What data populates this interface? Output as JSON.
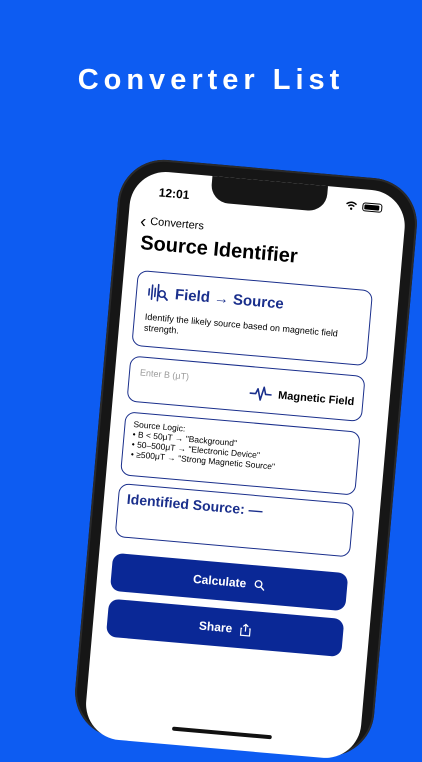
{
  "promo": {
    "title": "Converter List"
  },
  "status": {
    "time": "12:01"
  },
  "nav": {
    "back_label": "Converters"
  },
  "page": {
    "title": "Source Identifier"
  },
  "header_card": {
    "heading": "Field → Source",
    "description": "Identify the likely source based on magnetic field strength."
  },
  "input": {
    "placeholder": "Enter B (μT)",
    "label": "Magnetic Field"
  },
  "logic": {
    "title": "Source Logic:",
    "lines": [
      "• B < 50μT → \"Background\"",
      "• 50–500μT → \"Electronic Device\"",
      "• ≥500μT → \"Strong Magnetic Source\""
    ]
  },
  "result": {
    "label": "Identified Source: —"
  },
  "buttons": {
    "calculate": "Calculate",
    "share": "Share"
  },
  "colors": {
    "background": "#0d5cf2",
    "accent": "#0a2896",
    "card_border": "#1a2f8c"
  },
  "icons": {
    "header": "sound-wave-search-icon",
    "field": "pulse-wave-icon",
    "calculate": "search-icon",
    "share": "share-icon"
  }
}
